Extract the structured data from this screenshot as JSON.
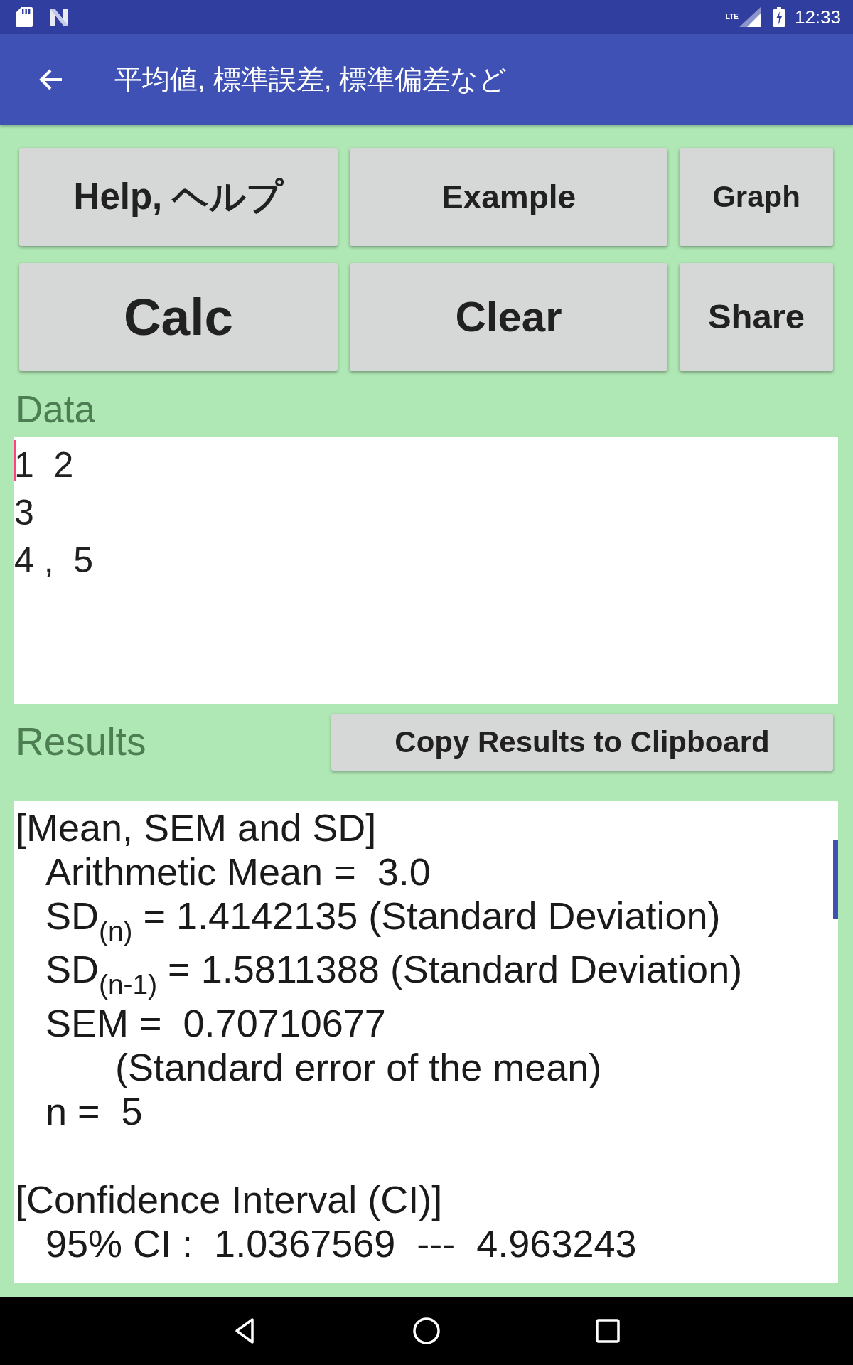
{
  "status_bar": {
    "network_label": "LTE",
    "time": "12:33"
  },
  "app_bar": {
    "title": "平均値, 標準誤差, 標準偏差など"
  },
  "button_rows": [
    [
      {
        "label": "Help, ヘルプ"
      },
      {
        "label": "Example"
      },
      {
        "label": "Graph"
      }
    ],
    [
      {
        "label": "Calc"
      },
      {
        "label": "Clear"
      },
      {
        "label": "Share"
      }
    ]
  ],
  "data": {
    "label": "Data",
    "lines": [
      "1  2",
      "3",
      "4 ,  5"
    ],
    "focused": true
  },
  "results": {
    "label": "Results",
    "copy_button": "Copy Results to Clipboard",
    "sections": [
      {
        "heading": "[Mean, SEM and SD]",
        "lines": [
          {
            "kind": "item",
            "text": "Arithmetic Mean =  3.0"
          },
          {
            "kind": "item",
            "text": "SD$_{(n)}$ = 1.4142135 (Standard Deviation)"
          },
          {
            "kind": "item",
            "text": "SD$_{(n-1)}$ = 1.5811388 (Standard Deviation)"
          },
          {
            "kind": "item",
            "text": "SEM =  0.70710677"
          },
          {
            "kind": "continuation",
            "text": "(Standard error of the mean)"
          },
          {
            "kind": "item",
            "text": "n =  5"
          }
        ]
      },
      {
        "heading": "[Confidence Interval (CI)]",
        "lines": [
          {
            "kind": "item",
            "text": "95% CI :  1.0367569  ---  4.963243"
          }
        ]
      }
    ]
  }
}
